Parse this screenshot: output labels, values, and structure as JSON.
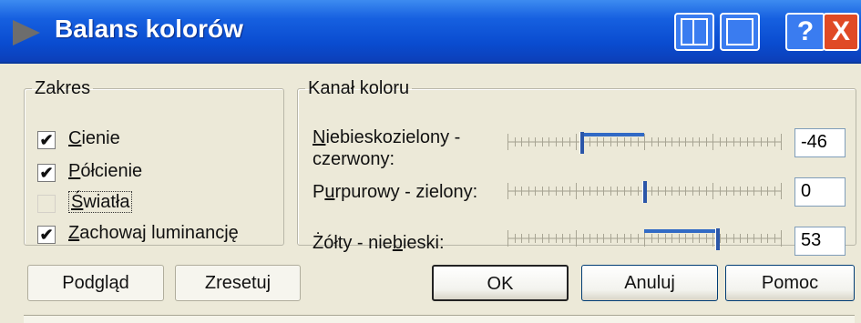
{
  "window": {
    "title": "Balans kolorów"
  },
  "zakres": {
    "legend": "Zakres",
    "items": [
      {
        "pre": "",
        "u": "C",
        "post": "ienie",
        "checked": true
      },
      {
        "pre": "",
        "u": "P",
        "post": "ółcienie",
        "checked": true
      },
      {
        "pre": "",
        "u": "Ś",
        "post": "wiatła",
        "checked": false
      },
      {
        "pre": "",
        "u": "Z",
        "post": "achowaj luminancję",
        "checked": true
      }
    ]
  },
  "kanal": {
    "legend": "Kanał koloru",
    "sliders": [
      {
        "label_line1_u": "N",
        "label_line1_rest": "iebieskozielony -",
        "label_line2": "czerwony:",
        "value": "-46",
        "level": -46
      },
      {
        "label_pre": "P",
        "label_u": "u",
        "label_post": "rpurowy - zielony:",
        "value": "0",
        "level": 0
      },
      {
        "label_pre": "Żółty - nie",
        "label_u": "b",
        "label_post": "ieski:",
        "value": "53",
        "level": 53
      }
    ]
  },
  "buttons": {
    "preview": "Podgląd",
    "reset": "Zresetuj",
    "ok": "OK",
    "cancel": "Anuluj",
    "help": "Pomoc"
  },
  "titlebar_buttons": {
    "help": "?",
    "close": "X"
  },
  "check_glyph": "✔"
}
